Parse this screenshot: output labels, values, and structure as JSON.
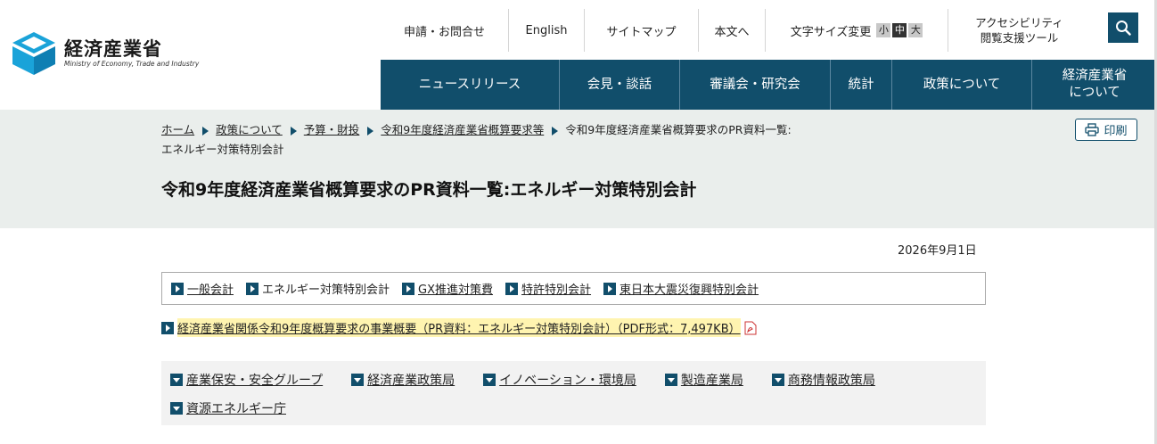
{
  "header": {
    "logo_ja": "経済産業省",
    "logo_en": "Ministry of Economy, Trade and Industry",
    "util": {
      "contact": "申請・お問合せ",
      "english": "English",
      "sitemap": "サイトマップ",
      "skip": "本文へ",
      "font_size_label": "文字サイズ変更",
      "font_small": "小",
      "font_medium": "中",
      "font_large": "大",
      "accessibility_line1": "アクセシビリティ",
      "accessibility_line2": "閲覧支援ツール"
    },
    "gnav": [
      {
        "label": "ニュースリリース"
      },
      {
        "label": "会見・談話"
      },
      {
        "label": "審議会・研究会"
      },
      {
        "label": "統計"
      },
      {
        "label": "政策について"
      },
      {
        "label_line1": "経済産業省",
        "label_line2": "について"
      }
    ]
  },
  "breadcrumb": {
    "items": [
      "ホーム",
      "政策について",
      "予算・財投",
      "令和9年度経済産業省概算要求等"
    ],
    "current_line1": "令和9年度経済産業省概算要求のPR資料一覧:",
    "current_line2": "エネルギー対策特別会計"
  },
  "print_label": "印刷",
  "page_title": "令和9年度経済産業省概算要求のPR資料一覧:エネルギー対策特別会計",
  "date": "2026年9月1日",
  "tabs": [
    "一般会計",
    "エネルギー対策特別会計",
    "GX推進対策費",
    "特許特別会計",
    "東日本大震災復興特別会計"
  ],
  "pdf_link": "経済産業省関係令和9年度概算要求の事業概要（PR資料：エネルギー対策特別会計）（PDF形式：7,497KB）",
  "bureaus": [
    "産業保安・安全グループ",
    "経済産業政策局",
    "イノベーション・環境局",
    "製造産業局",
    "商務情報政策局",
    "資源エネルギー庁"
  ],
  "colors": {
    "brand": "#114e6b",
    "band_bg": "#eaeeec",
    "highlight": "#fff4b0"
  }
}
